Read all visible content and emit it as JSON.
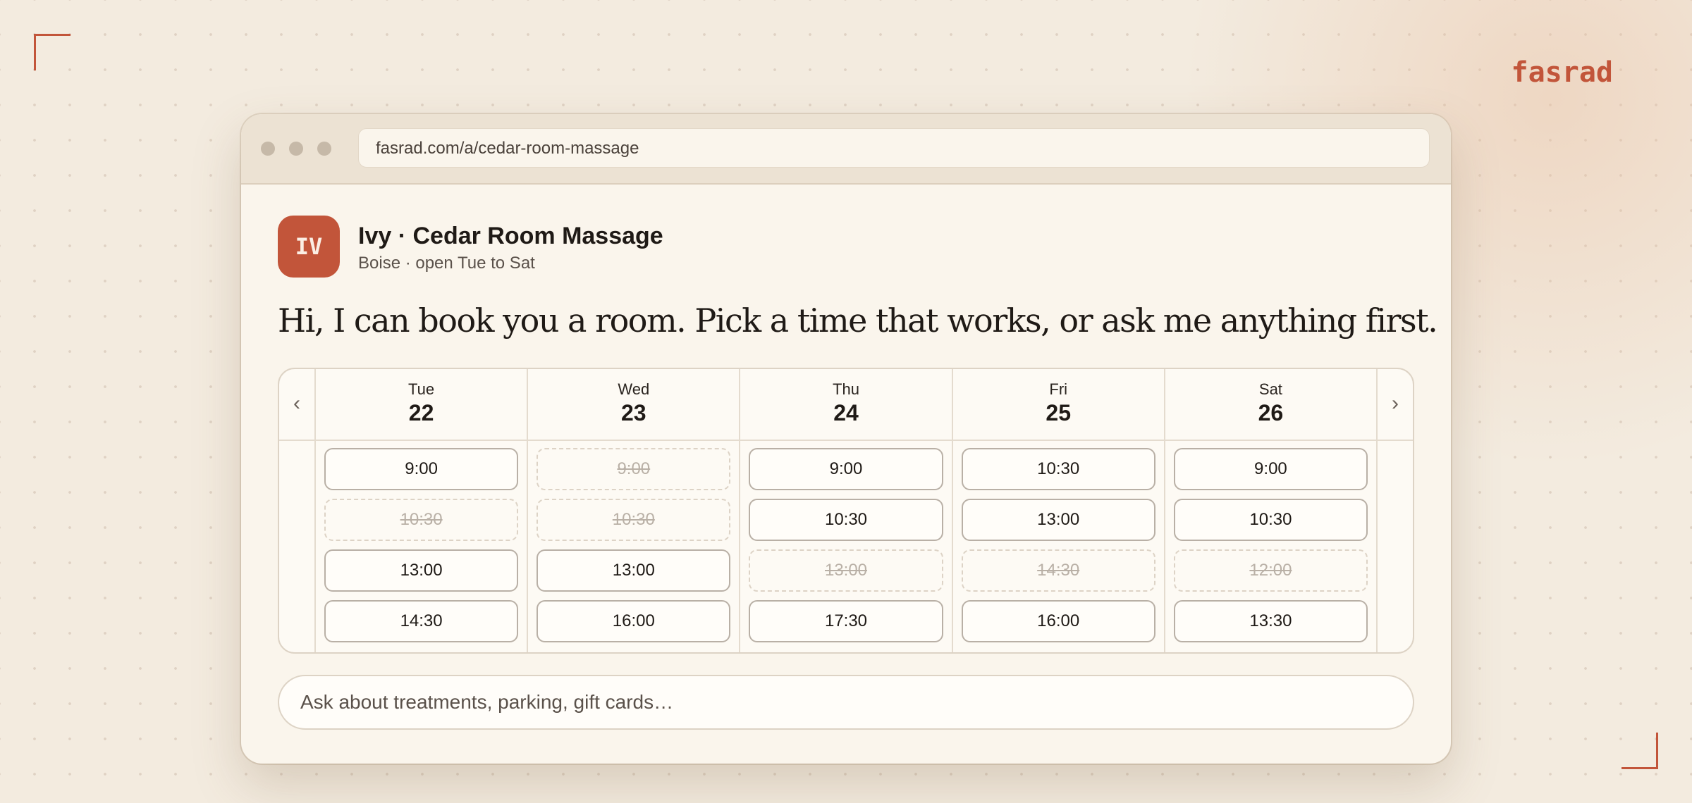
{
  "brand": "fasrad",
  "browser": {
    "url": "fasrad.com/a/cedar-room-massage"
  },
  "business": {
    "initials": "IV",
    "name": "Ivy · Cedar Room Massage",
    "subtitle": "Boise · open Tue to Sat"
  },
  "greeting": "Hi, I can book you a room. Pick a time that works, or ask me anything first.",
  "calendar": {
    "prev": "‹",
    "next": "›",
    "days": [
      {
        "name": "Tue",
        "num": "22",
        "slots": [
          {
            "time": "9:00",
            "available": true
          },
          {
            "time": "10:30",
            "available": false
          },
          {
            "time": "13:00",
            "available": true
          },
          {
            "time": "14:30",
            "available": true
          }
        ]
      },
      {
        "name": "Wed",
        "num": "23",
        "slots": [
          {
            "time": "9:00",
            "available": false
          },
          {
            "time": "10:30",
            "available": false
          },
          {
            "time": "13:00",
            "available": true
          },
          {
            "time": "16:00",
            "available": true
          }
        ]
      },
      {
        "name": "Thu",
        "num": "24",
        "slots": [
          {
            "time": "9:00",
            "available": true
          },
          {
            "time": "10:30",
            "available": true
          },
          {
            "time": "13:00",
            "available": false
          },
          {
            "time": "17:30",
            "available": true
          }
        ]
      },
      {
        "name": "Fri",
        "num": "25",
        "slots": [
          {
            "time": "10:30",
            "available": true
          },
          {
            "time": "13:00",
            "available": true
          },
          {
            "time": "14:30",
            "available": false
          },
          {
            "time": "16:00",
            "available": true
          }
        ]
      },
      {
        "name": "Sat",
        "num": "26",
        "slots": [
          {
            "time": "9:00",
            "available": true
          },
          {
            "time": "10:30",
            "available": true
          },
          {
            "time": "12:00",
            "available": false
          },
          {
            "time": "13:30",
            "available": true
          }
        ]
      }
    ]
  },
  "ask": {
    "placeholder": "Ask about treatments, parking, gift cards…",
    "value": ""
  },
  "colors": {
    "accent": "#c2553a",
    "background": "#f3ebdf",
    "card": "#faf5ec"
  }
}
